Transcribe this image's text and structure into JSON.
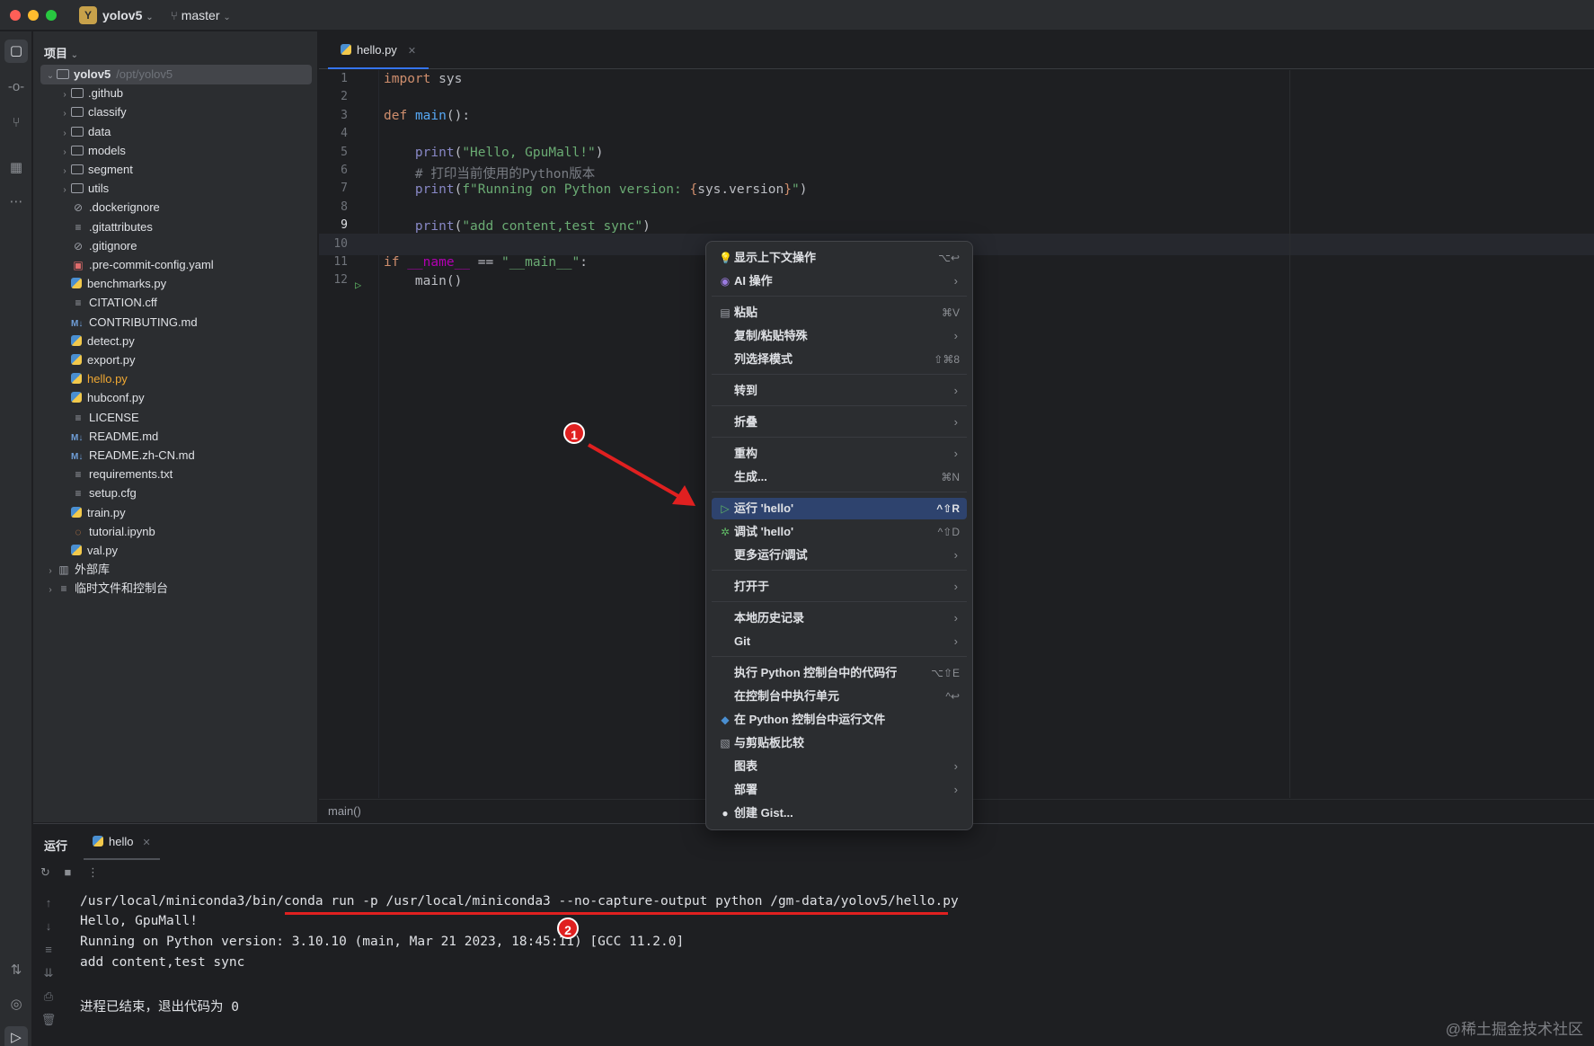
{
  "titlebar": {
    "project_badge": "Y",
    "project_name": "yolov5",
    "branch": "master"
  },
  "project_panel": {
    "title": "项目",
    "root": {
      "name": "yolov5",
      "path": "/opt/yolov5"
    },
    "items": [
      {
        "label": ".github",
        "kind": "folder"
      },
      {
        "label": "classify",
        "kind": "folder"
      },
      {
        "label": "data",
        "kind": "folder"
      },
      {
        "label": "models",
        "kind": "folder"
      },
      {
        "label": "segment",
        "kind": "folder"
      },
      {
        "label": "utils",
        "kind": "folder"
      },
      {
        "label": ".dockerignore",
        "kind": "ignore"
      },
      {
        "label": ".gitattributes",
        "kind": "text"
      },
      {
        "label": ".gitignore",
        "kind": "ignore"
      },
      {
        "label": ".pre-commit-config.yaml",
        "kind": "yaml"
      },
      {
        "label": "benchmarks.py",
        "kind": "py"
      },
      {
        "label": "CITATION.cff",
        "kind": "text"
      },
      {
        "label": "CONTRIBUTING.md",
        "kind": "md"
      },
      {
        "label": "detect.py",
        "kind": "py"
      },
      {
        "label": "export.py",
        "kind": "py"
      },
      {
        "label": "hello.py",
        "kind": "py"
      },
      {
        "label": "hubconf.py",
        "kind": "py"
      },
      {
        "label": "LICENSE",
        "kind": "text"
      },
      {
        "label": "README.md",
        "kind": "md"
      },
      {
        "label": "README.zh-CN.md",
        "kind": "md"
      },
      {
        "label": "requirements.txt",
        "kind": "text"
      },
      {
        "label": "setup.cfg",
        "kind": "text"
      },
      {
        "label": "train.py",
        "kind": "py"
      },
      {
        "label": "tutorial.ipynb",
        "kind": "ipynb"
      },
      {
        "label": "val.py",
        "kind": "py"
      }
    ],
    "external_libs": "外部库",
    "scratches": "临时文件和控制台"
  },
  "editor": {
    "tab_label": "hello.py",
    "line_numbers": [
      "1",
      "2",
      "3",
      "4",
      "5",
      "6",
      "7",
      "8",
      "9",
      "10",
      "11",
      "12"
    ],
    "breadcrumb": "main()"
  },
  "context_menu": {
    "items": [
      {
        "label": "显示上下文操作",
        "shortcut": "⌥↩",
        "icon": "bulb-icon",
        "submenu": false
      },
      {
        "label": "AI 操作",
        "shortcut": "",
        "icon": "ai-icon",
        "submenu": true
      },
      {
        "label": "粘贴",
        "shortcut": "⌘V",
        "icon": "clipboard-icon",
        "submenu": false
      },
      {
        "label": "复制/粘贴特殊",
        "shortcut": "",
        "icon": "",
        "submenu": true
      },
      {
        "label": "列选择模式",
        "shortcut": "⇧⌘8",
        "icon": "",
        "submenu": false
      },
      {
        "label": "转到",
        "shortcut": "",
        "icon": "",
        "submenu": true
      },
      {
        "label": "折叠",
        "shortcut": "",
        "icon": "",
        "submenu": true
      },
      {
        "label": "重构",
        "shortcut": "",
        "icon": "",
        "submenu": true
      },
      {
        "label": "生成...",
        "shortcut": "⌘N",
        "icon": "",
        "submenu": false
      },
      {
        "label": "运行 'hello'",
        "shortcut": "^⇧R",
        "icon": "run-icon",
        "submenu": false
      },
      {
        "label": "调试 'hello'",
        "shortcut": "^⇧D",
        "icon": "debug-icon",
        "submenu": false
      },
      {
        "label": "更多运行/调试",
        "shortcut": "",
        "icon": "",
        "submenu": true
      },
      {
        "label": "打开于",
        "shortcut": "",
        "icon": "",
        "submenu": true
      },
      {
        "label": "本地历史记录",
        "shortcut": "",
        "icon": "",
        "submenu": true
      },
      {
        "label": "Git",
        "shortcut": "",
        "icon": "",
        "submenu": true
      },
      {
        "label": "执行 Python 控制台中的代码行",
        "shortcut": "⌥⇧E",
        "icon": "",
        "submenu": false
      },
      {
        "label": "在控制台中执行单元",
        "shortcut": "^↩",
        "icon": "",
        "submenu": false
      },
      {
        "label": "在 Python 控制台中运行文件",
        "shortcut": "",
        "icon": "python-icon",
        "submenu": false
      },
      {
        "label": "与剪贴板比较",
        "shortcut": "",
        "icon": "compare-icon",
        "submenu": false
      },
      {
        "label": "图表",
        "shortcut": "",
        "icon": "",
        "submenu": true
      },
      {
        "label": "部署",
        "shortcut": "",
        "icon": "",
        "submenu": true
      },
      {
        "label": "创建 Gist...",
        "shortcut": "",
        "icon": "github-icon",
        "submenu": false
      }
    ]
  },
  "run_panel": {
    "title": "运行",
    "tab_label": "hello",
    "console": [
      "/usr/local/miniconda3/bin/conda run -p /usr/local/miniconda3 --no-capture-output python /gm-data/yolov5/hello.py",
      "Hello, GpuMall!",
      "Running on Python version: 3.10.10 (main, Mar 21 2023, 18:45:11) [GCC 11.2.0]",
      "add content,test sync",
      "",
      "进程已结束，退出代码为 0"
    ]
  },
  "annotations": {
    "badge1": "1",
    "badge2": "2"
  },
  "watermark": "@稀土掘金技术社区",
  "colors": {
    "accent": "#3574f0",
    "highlight": "#2e436e",
    "annotation_red": "#e02020"
  }
}
